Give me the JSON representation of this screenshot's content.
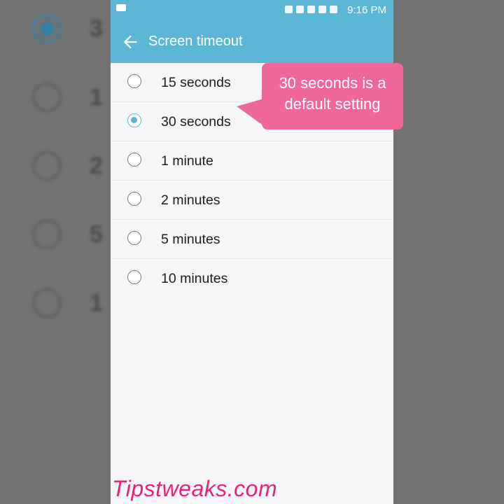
{
  "status_bar": {
    "time": "9:16 PM"
  },
  "app_bar": {
    "title": "Screen timeout",
    "back_icon": "arrow-left-icon"
  },
  "options": [
    {
      "label": "15 seconds",
      "checked": false
    },
    {
      "label": "30 seconds",
      "checked": true
    },
    {
      "label": "1 minute",
      "checked": false
    },
    {
      "label": "2 minutes",
      "checked": false
    },
    {
      "label": "5 minutes",
      "checked": false
    },
    {
      "label": "10 minutes",
      "checked": false
    }
  ],
  "callout": {
    "line1": "30 seconds is a",
    "line2": "default setting"
  },
  "watermark": "Tipstweaks.com",
  "colors": {
    "accent": "#5bb6d6",
    "callout": "#f0689a",
    "watermark": "#e8227a"
  }
}
